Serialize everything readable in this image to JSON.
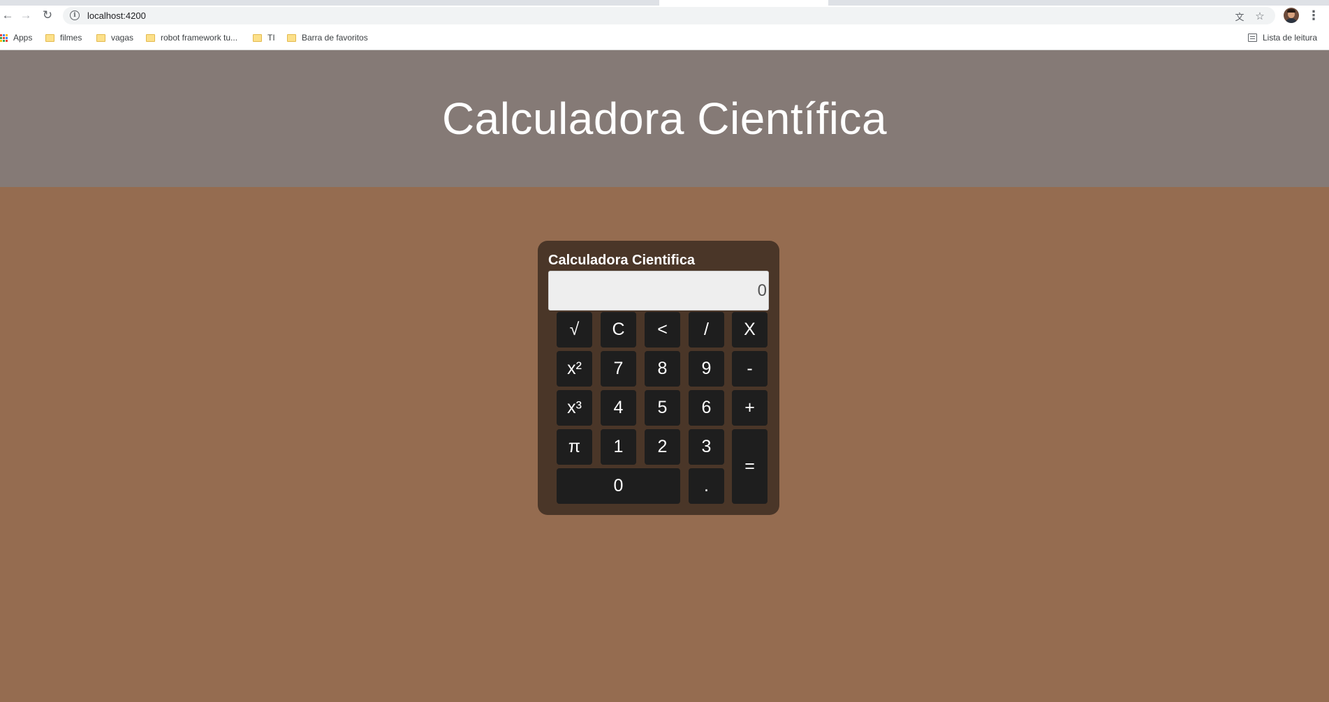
{
  "browser": {
    "url": "localhost:4200",
    "bookmarks": [
      {
        "label": "Apps",
        "icon": "apps-grid-icon"
      },
      {
        "label": "filmes",
        "icon": "folder-icon"
      },
      {
        "label": "vagas",
        "icon": "folder-icon"
      },
      {
        "label": "robot framework tu...",
        "icon": "folder-icon"
      },
      {
        "label": "TI",
        "icon": "folder-icon"
      },
      {
        "label": "Barra de favoritos",
        "icon": "folder-icon"
      }
    ],
    "reading_list": "Lista de leitura"
  },
  "page": {
    "title": "Calculadora Científica",
    "header_bg": "#857a76",
    "body_bg": "#956c50"
  },
  "calculator": {
    "title": "Calculadora Cientifica",
    "display_value": "0",
    "keys": {
      "sqrt": "√",
      "clear": "C",
      "backspace": "<",
      "divide": "/",
      "multiply": "X",
      "square": "x²",
      "k7": "7",
      "k8": "8",
      "k9": "9",
      "minus": "-",
      "cube": "x³",
      "k4": "4",
      "k5": "5",
      "k6": "6",
      "plus": "+",
      "pi": "π",
      "k1": "1",
      "k2": "2",
      "k3": "3",
      "equals": "=",
      "k0": "0",
      "decimal": "."
    },
    "panel_bg": "#4a3628",
    "key_bg": "#1e1e1e"
  }
}
